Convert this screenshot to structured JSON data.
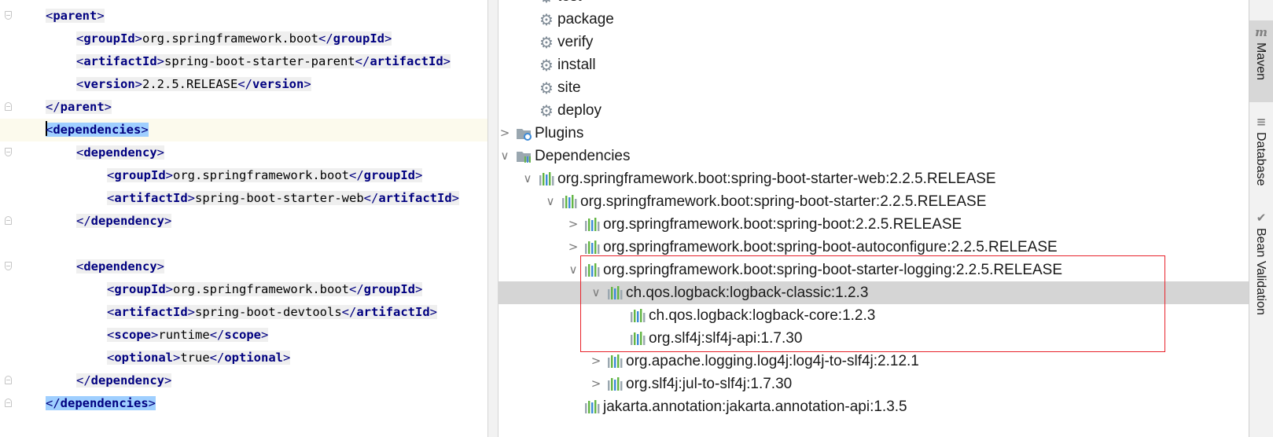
{
  "editor": {
    "lines": [
      {
        "indent": 0,
        "parts": [
          {
            "t": "<",
            "c": "br"
          },
          {
            "t": "parent",
            "c": "tb"
          },
          {
            "t": ">",
            "c": "br"
          }
        ],
        "fold": "start"
      },
      {
        "indent": 1,
        "parts": [
          {
            "t": "<",
            "c": "br"
          },
          {
            "t": "groupId",
            "c": "tb"
          },
          {
            "t": ">",
            "c": "br"
          },
          {
            "t": "org.springframework.boot"
          },
          {
            "t": "</",
            "c": "br"
          },
          {
            "t": "groupId",
            "c": "tb"
          },
          {
            "t": ">",
            "c": "br"
          }
        ]
      },
      {
        "indent": 1,
        "parts": [
          {
            "t": "<",
            "c": "br"
          },
          {
            "t": "artifactId",
            "c": "tb"
          },
          {
            "t": ">",
            "c": "br"
          },
          {
            "t": "spring-boot-starter-parent"
          },
          {
            "t": "</",
            "c": "br"
          },
          {
            "t": "artifactId",
            "c": "tb"
          },
          {
            "t": ">",
            "c": "br"
          }
        ]
      },
      {
        "indent": 1,
        "parts": [
          {
            "t": "<",
            "c": "br"
          },
          {
            "t": "version",
            "c": "tb"
          },
          {
            "t": ">",
            "c": "br"
          },
          {
            "t": "2.2.5.RELEASE"
          },
          {
            "t": "</",
            "c": "br"
          },
          {
            "t": "version",
            "c": "tb"
          },
          {
            "t": ">",
            "c": "br"
          }
        ]
      },
      {
        "indent": 0,
        "parts": [
          {
            "t": "</",
            "c": "br"
          },
          {
            "t": "parent",
            "c": "tb"
          },
          {
            "t": ">",
            "c": "br"
          }
        ],
        "fold": "end"
      },
      {
        "indent": 0,
        "current": true,
        "selected": true,
        "caret": true,
        "parts": [
          {
            "t": "<",
            "c": "br"
          },
          {
            "t": "dependencies",
            "c": "tb"
          },
          {
            "t": ">",
            "c": "br"
          }
        ],
        "fold": "start"
      },
      {
        "indent": 1,
        "parts": [
          {
            "t": "<",
            "c": "br"
          },
          {
            "t": "dependency",
            "c": "tb"
          },
          {
            "t": ">",
            "c": "br"
          }
        ],
        "fold": "start"
      },
      {
        "indent": 2,
        "parts": [
          {
            "t": "<",
            "c": "br"
          },
          {
            "t": "groupId",
            "c": "tb"
          },
          {
            "t": ">",
            "c": "br"
          },
          {
            "t": "org.springframework.boot"
          },
          {
            "t": "</",
            "c": "br"
          },
          {
            "t": "groupId",
            "c": "tb"
          },
          {
            "t": ">",
            "c": "br"
          }
        ]
      },
      {
        "indent": 2,
        "parts": [
          {
            "t": "<",
            "c": "br"
          },
          {
            "t": "artifactId",
            "c": "tb"
          },
          {
            "t": ">",
            "c": "br"
          },
          {
            "t": "spring-boot-starter-web"
          },
          {
            "t": "</",
            "c": "br"
          },
          {
            "t": "artifactId",
            "c": "tb"
          },
          {
            "t": ">",
            "c": "br"
          }
        ]
      },
      {
        "indent": 1,
        "parts": [
          {
            "t": "</",
            "c": "br"
          },
          {
            "t": "dependency",
            "c": "tb"
          },
          {
            "t": ">",
            "c": "br"
          }
        ],
        "fold": "end"
      },
      {
        "indent": 0,
        "parts": []
      },
      {
        "indent": 1,
        "parts": [
          {
            "t": "<",
            "c": "br"
          },
          {
            "t": "dependency",
            "c": "tb"
          },
          {
            "t": ">",
            "c": "br"
          }
        ],
        "fold": "start"
      },
      {
        "indent": 2,
        "parts": [
          {
            "t": "<",
            "c": "br"
          },
          {
            "t": "groupId",
            "c": "tb"
          },
          {
            "t": ">",
            "c": "br"
          },
          {
            "t": "org.springframework.boot"
          },
          {
            "t": "</",
            "c": "br"
          },
          {
            "t": "groupId",
            "c": "tb"
          },
          {
            "t": ">",
            "c": "br"
          }
        ]
      },
      {
        "indent": 2,
        "parts": [
          {
            "t": "<",
            "c": "br"
          },
          {
            "t": "artifactId",
            "c": "tb"
          },
          {
            "t": ">",
            "c": "br"
          },
          {
            "t": "spring-boot-devtools"
          },
          {
            "t": "</",
            "c": "br"
          },
          {
            "t": "artifactId",
            "c": "tb"
          },
          {
            "t": ">",
            "c": "br"
          }
        ]
      },
      {
        "indent": 2,
        "parts": [
          {
            "t": "<",
            "c": "br"
          },
          {
            "t": "scope",
            "c": "tb"
          },
          {
            "t": ">",
            "c": "br"
          },
          {
            "t": "runtime"
          },
          {
            "t": "</",
            "c": "br"
          },
          {
            "t": "scope",
            "c": "tb"
          },
          {
            "t": ">",
            "c": "br"
          }
        ]
      },
      {
        "indent": 2,
        "parts": [
          {
            "t": "<",
            "c": "br"
          },
          {
            "t": "optional",
            "c": "tb"
          },
          {
            "t": ">",
            "c": "br"
          },
          {
            "t": "true"
          },
          {
            "t": "</",
            "c": "br"
          },
          {
            "t": "optional",
            "c": "tb"
          },
          {
            "t": ">",
            "c": "br"
          }
        ]
      },
      {
        "indent": 1,
        "parts": [
          {
            "t": "</",
            "c": "br"
          },
          {
            "t": "dependency",
            "c": "tb"
          },
          {
            "t": ">",
            "c": "br"
          }
        ],
        "fold": "end"
      },
      {
        "indent": 0,
        "selected": true,
        "parts": [
          {
            "t": "</",
            "c": "br"
          },
          {
            "t": "dependencies",
            "c": "tb"
          },
          {
            "t": ">",
            "c": "br"
          }
        ],
        "fold": "end"
      }
    ]
  },
  "maven_tree": {
    "rows": [
      {
        "depth": 2,
        "icon": "gear",
        "label": "test"
      },
      {
        "depth": 2,
        "icon": "gear",
        "label": "package"
      },
      {
        "depth": 2,
        "icon": "gear",
        "label": "verify"
      },
      {
        "depth": 2,
        "icon": "gear",
        "label": "install"
      },
      {
        "depth": 2,
        "icon": "gear",
        "label": "site"
      },
      {
        "depth": 2,
        "icon": "gear",
        "label": "deploy"
      },
      {
        "depth": 1,
        "chevron": "collapsed",
        "icon": "plugins-folder",
        "label": "Plugins"
      },
      {
        "depth": 1,
        "chevron": "expanded",
        "icon": "deps-folder",
        "label": "Dependencies"
      },
      {
        "depth": 2,
        "chevron": "expanded",
        "icon": "library",
        "label": "org.springframework.boot:spring-boot-starter-web:2.2.5.RELEASE"
      },
      {
        "depth": 3,
        "chevron": "expanded",
        "icon": "library",
        "label": "org.springframework.boot:spring-boot-starter:2.2.5.RELEASE"
      },
      {
        "depth": 4,
        "chevron": "collapsed",
        "icon": "library",
        "label": "org.springframework.boot:spring-boot:2.2.5.RELEASE"
      },
      {
        "depth": 4,
        "chevron": "collapsed",
        "icon": "library",
        "label": "org.springframework.boot:spring-boot-autoconfigure:2.2.5.RELEASE"
      },
      {
        "depth": 4,
        "chevron": "expanded",
        "icon": "library",
        "label": "org.springframework.boot:spring-boot-starter-logging:2.2.5.RELEASE"
      },
      {
        "depth": 5,
        "chevron": "expanded",
        "icon": "library",
        "label": "ch.qos.logback:logback-classic:1.2.3",
        "selected": true
      },
      {
        "depth": 6,
        "icon": "library",
        "label": "ch.qos.logback:logback-core:1.2.3"
      },
      {
        "depth": 6,
        "icon": "library",
        "label": "org.slf4j:slf4j-api:1.7.30"
      },
      {
        "depth": 5,
        "chevron": "collapsed",
        "icon": "library",
        "label": "org.apache.logging.log4j:log4j-to-slf4j:2.12.1"
      },
      {
        "depth": 5,
        "chevron": "collapsed",
        "icon": "library",
        "label": "org.slf4j:jul-to-slf4j:1.7.30"
      },
      {
        "depth": 4,
        "icon": "library",
        "label": "jakarta.annotation:jakarta.annotation-api:1.3.5"
      }
    ]
  },
  "tool_strip": {
    "top_partial": "h",
    "tools": [
      {
        "name": "maven",
        "icon": "m",
        "label": "Maven",
        "active": true
      },
      {
        "name": "database",
        "icon": "≡",
        "label": "Database",
        "active": false
      },
      {
        "name": "bean-validation",
        "icon": "✔",
        "label": "Bean Validation",
        "active": false
      }
    ]
  },
  "colors": {
    "tag": "#000080",
    "selection": "#9fcfff",
    "current_line": "#fcfaed",
    "tree_selection": "#d5d5d5",
    "highlight_box": "#e8232b",
    "lib_green": "#62b543",
    "lib_blue": "#3d8bd8",
    "lib_gray": "#9aa7b0"
  }
}
